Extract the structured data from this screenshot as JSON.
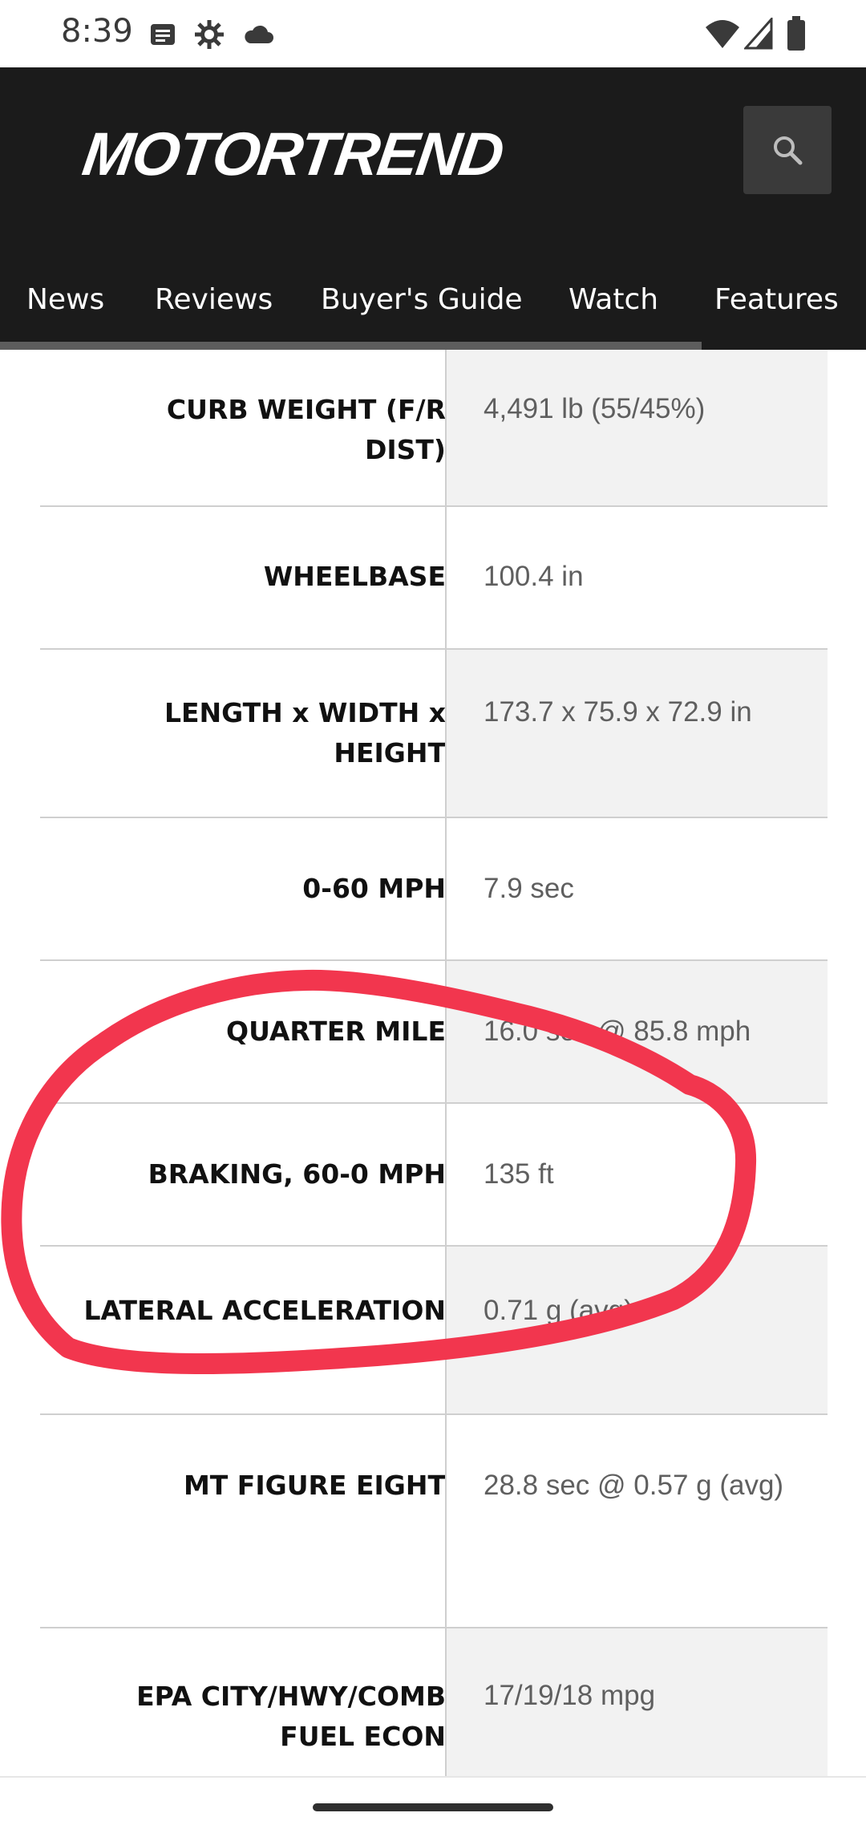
{
  "status_bar": {
    "time": "8:39",
    "left_icons": [
      "message-icon",
      "settings-icon",
      "cloud-icon"
    ],
    "right_icons": [
      "wifi-icon",
      "signal-icon",
      "battery-icon"
    ]
  },
  "header": {
    "logo_text": "MOTORTREND",
    "search_icon": "search-icon"
  },
  "nav": {
    "items": [
      {
        "label": "News"
      },
      {
        "label": "Reviews"
      },
      {
        "label": "Buyer's Guide"
      },
      {
        "label": "Watch"
      },
      {
        "label": "Features"
      }
    ]
  },
  "specs": {
    "rows": [
      {
        "label": "CURB WEIGHT (F/R DIST)",
        "value": "4,491 lb (55/45%)"
      },
      {
        "label": "WHEELBASE",
        "value": "100.4 in"
      },
      {
        "label": "LENGTH x WIDTH x HEIGHT",
        "value": "173.7 x 75.9 x 72.9 in"
      },
      {
        "label": "0-60 MPH",
        "value": "7.9 sec"
      },
      {
        "label": "QUARTER MILE",
        "value": "16.0 sec @ 85.8 mph"
      },
      {
        "label": "BRAKING, 60-0 MPH",
        "value": "135 ft"
      },
      {
        "label": "LATERAL ACCELERATION",
        "value": "0.71 g (avg)"
      },
      {
        "label": "MT FIGURE EIGHT",
        "value": "28.8 sec @ 0.57 g (avg)"
      },
      {
        "label": "EPA CITY/HWY/COMB FUEL ECON",
        "value": "17/19/18 mpg"
      }
    ]
  },
  "colors": {
    "header_bg": "#1b1b1b",
    "annotation": "#f2364e",
    "shaded_cell": "#f2f2f2"
  }
}
